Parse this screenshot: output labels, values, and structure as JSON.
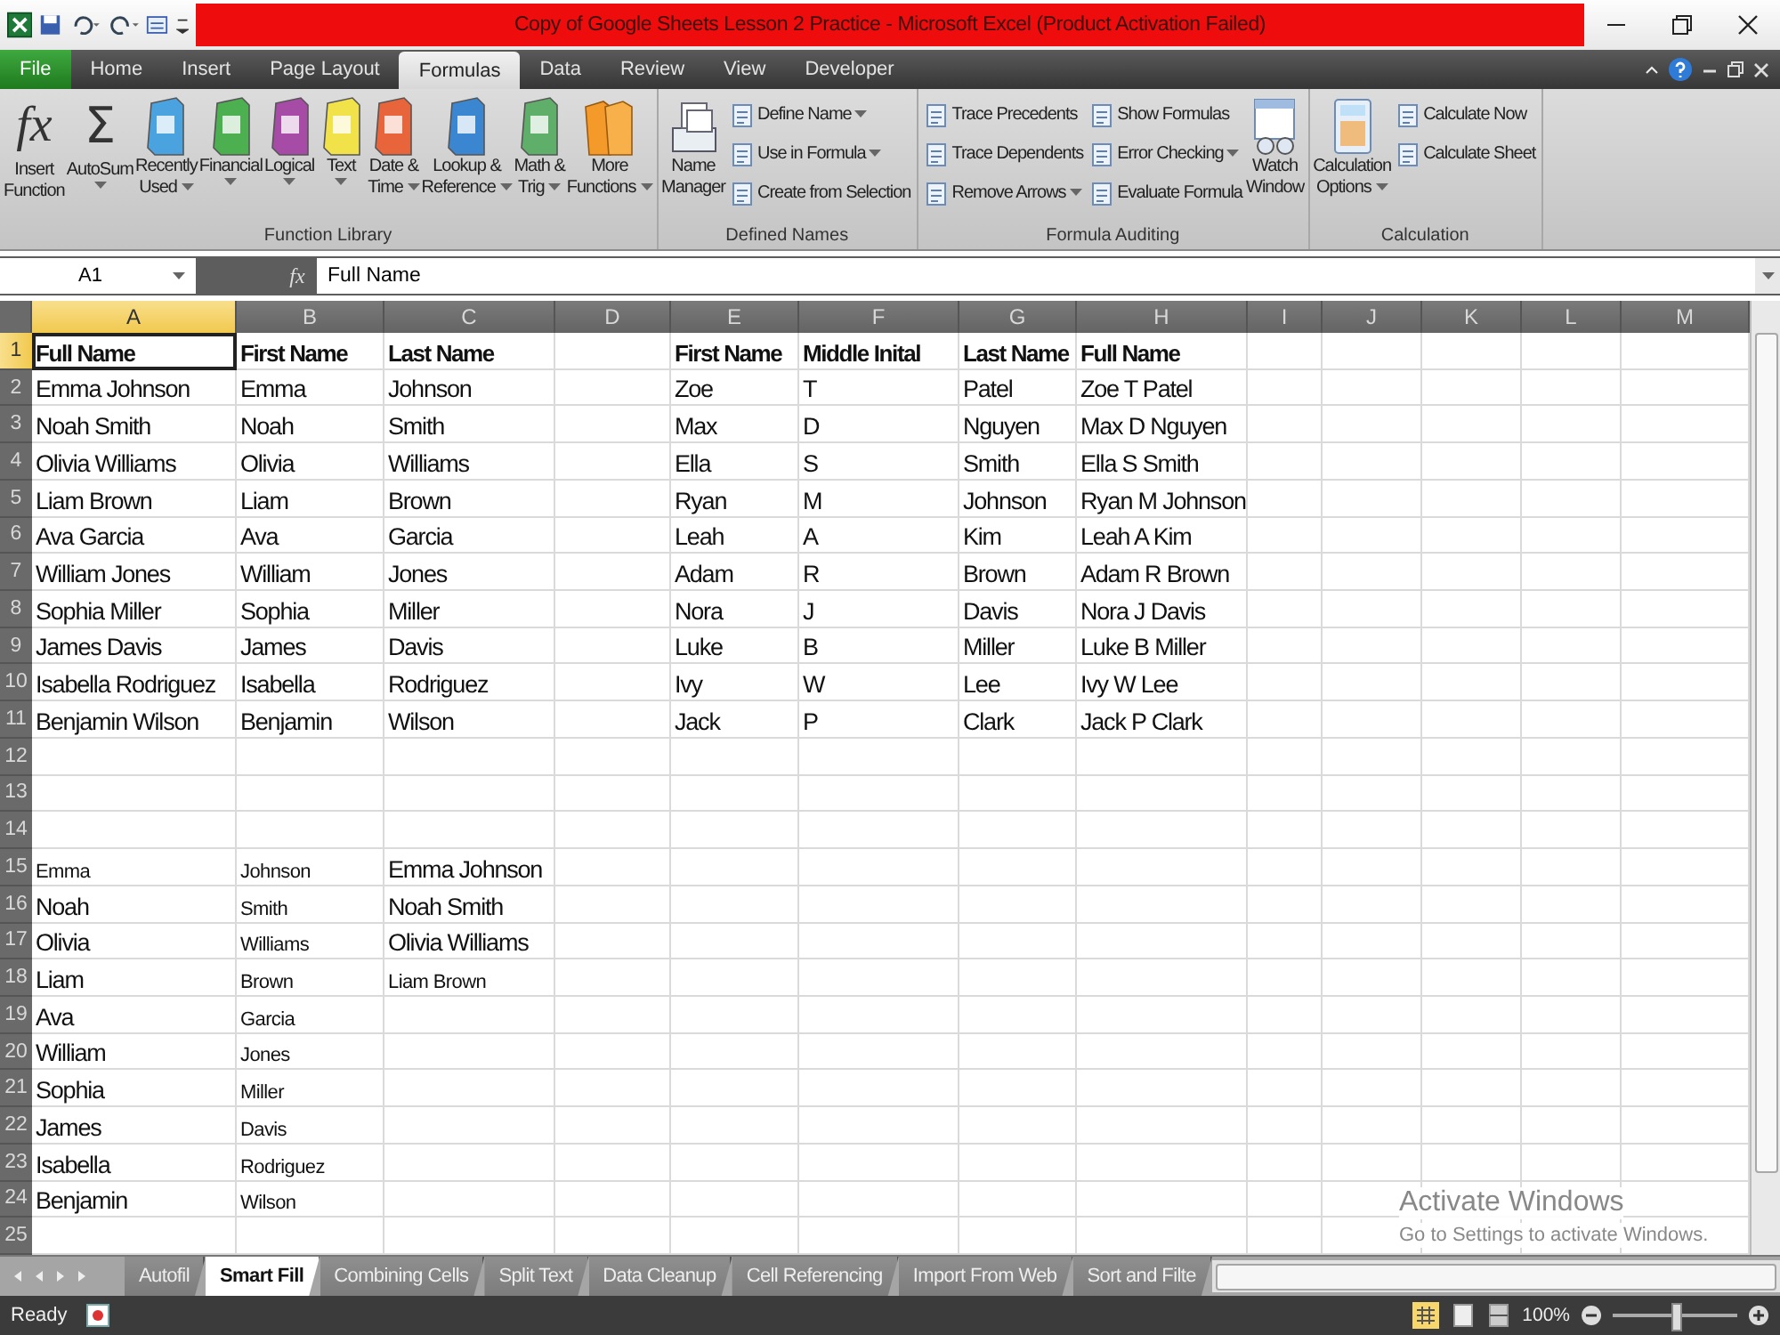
{
  "window": {
    "title": "Copy of Google Sheets Lesson 2 Practice  -  Microsoft Excel (Product Activation Failed)"
  },
  "menu_tabs": [
    {
      "label": "File",
      "kind": "file",
      "selected": false
    },
    {
      "label": "Home",
      "kind": "tab",
      "selected": false
    },
    {
      "label": "Insert",
      "kind": "tab",
      "selected": false
    },
    {
      "label": "Page Layout",
      "kind": "tab",
      "selected": false
    },
    {
      "label": "Formulas",
      "kind": "tab",
      "selected": true
    },
    {
      "label": "Data",
      "kind": "tab",
      "selected": false
    },
    {
      "label": "Review",
      "kind": "tab",
      "selected": false
    },
    {
      "label": "View",
      "kind": "tab",
      "selected": false
    },
    {
      "label": "Developer",
      "kind": "tab",
      "selected": false
    }
  ],
  "ribbon": {
    "groups": [
      {
        "label": "Function Library",
        "items": [
          {
            "kind": "large",
            "glyph": "fx",
            "lines": [
              "Insert",
              "Function"
            ],
            "dropdown": false
          },
          {
            "kind": "large",
            "glyph": "Σ",
            "lines": [
              "AutoSum"
            ],
            "dropdown": true
          },
          {
            "kind": "large",
            "lines": [
              "Recently",
              "Used"
            ],
            "dropdown": true
          },
          {
            "kind": "large",
            "lines": [
              "Financial"
            ],
            "dropdown": true
          },
          {
            "kind": "large",
            "lines": [
              "Logical"
            ],
            "dropdown": true
          },
          {
            "kind": "large",
            "lines": [
              "Text"
            ],
            "dropdown": true
          },
          {
            "kind": "large",
            "lines": [
              "Date &",
              "Time"
            ],
            "dropdown": true
          },
          {
            "kind": "large",
            "lines": [
              "Lookup &",
              "Reference"
            ],
            "dropdown": true
          },
          {
            "kind": "large",
            "lines": [
              "Math &",
              "Trig"
            ],
            "dropdown": true
          },
          {
            "kind": "large",
            "lines": [
              "More",
              "Functions"
            ],
            "dropdown": true
          }
        ]
      },
      {
        "label": "Defined Names",
        "items": [
          {
            "kind": "large",
            "lines": [
              "Name",
              "Manager"
            ],
            "dropdown": false
          },
          {
            "kind": "stack",
            "items": [
              {
                "label": "Define Name",
                "dropdown": true
              },
              {
                "label": "Use in Formula",
                "dropdown": true
              },
              {
                "label": "Create from Selection",
                "dropdown": false
              }
            ]
          }
        ]
      },
      {
        "label": "Formula Auditing",
        "items": [
          {
            "kind": "stack",
            "items": [
              {
                "label": "Trace Precedents",
                "dropdown": false
              },
              {
                "label": "Trace Dependents",
                "dropdown": false
              },
              {
                "label": "Remove Arrows",
                "dropdown": true
              }
            ]
          },
          {
            "kind": "stack",
            "items": [
              {
                "label": "Show Formulas",
                "dropdown": false
              },
              {
                "label": "Error Checking",
                "dropdown": true
              },
              {
                "label": "Evaluate Formula",
                "dropdown": false
              }
            ]
          },
          {
            "kind": "large",
            "lines": [
              "Watch",
              "Window"
            ],
            "dropdown": false
          }
        ]
      },
      {
        "label": "Calculation",
        "items": [
          {
            "kind": "large",
            "lines": [
              "Calculation",
              "Options"
            ],
            "dropdown": true
          },
          {
            "kind": "stack",
            "items": [
              {
                "label": "Calculate Now",
                "dropdown": false
              },
              {
                "label": "Calculate Sheet",
                "dropdown": false
              }
            ]
          }
        ]
      }
    ]
  },
  "formula_bar": {
    "name_box": "A1",
    "fx": "fx",
    "value": "Full Name"
  },
  "sheet": {
    "columns": [
      {
        "label": "A",
        "selected": true
      },
      {
        "label": "B",
        "selected": false
      },
      {
        "label": "C",
        "selected": false
      },
      {
        "label": "D",
        "selected": false
      },
      {
        "label": "E",
        "selected": false
      },
      {
        "label": "F",
        "selected": false
      },
      {
        "label": "G",
        "selected": false
      },
      {
        "label": "H",
        "selected": false
      },
      {
        "label": "I",
        "selected": false
      },
      {
        "label": "J",
        "selected": false
      },
      {
        "label": "K",
        "selected": false
      },
      {
        "label": "L",
        "selected": false
      },
      {
        "label": "M",
        "selected": false
      }
    ],
    "rows": [
      {
        "number": "1",
        "selected": true,
        "cells": [
          {
            "text": "Full Name",
            "kind": "header",
            "active": true
          },
          {
            "text": "First Name",
            "kind": "header"
          },
          {
            "text": "Last Name",
            "kind": "header"
          },
          {},
          {
            "text": "First Name",
            "kind": "header"
          },
          {
            "text": "Middle Inital",
            "kind": "header"
          },
          {
            "text": "Last Name",
            "kind": "header"
          },
          {
            "text": "Full Name",
            "kind": "header"
          }
        ]
      },
      {
        "number": "2",
        "selected": false,
        "cells": [
          {
            "text": "Emma Johnson"
          },
          {
            "text": "Emma"
          },
          {
            "text": "Johnson"
          },
          {},
          {
            "text": "Zoe"
          },
          {
            "text": "T"
          },
          {
            "text": "Patel"
          },
          {
            "text": "Zoe T Patel"
          }
        ]
      },
      {
        "number": "3",
        "selected": false,
        "cells": [
          {
            "text": "Noah Smith"
          },
          {
            "text": "Noah"
          },
          {
            "text": "Smith"
          },
          {},
          {
            "text": "Max"
          },
          {
            "text": "D"
          },
          {
            "text": "Nguyen"
          },
          {
            "text": "Max D Nguyen"
          }
        ]
      },
      {
        "number": "4",
        "selected": false,
        "cells": [
          {
            "text": "Olivia Williams"
          },
          {
            "text": "Olivia"
          },
          {
            "text": "Williams"
          },
          {},
          {
            "text": "Ella"
          },
          {
            "text": "S"
          },
          {
            "text": "Smith"
          },
          {
            "text": "Ella S Smith"
          }
        ]
      },
      {
        "number": "5",
        "selected": false,
        "cells": [
          {
            "text": "Liam Brown"
          },
          {
            "text": "Liam"
          },
          {
            "text": "Brown"
          },
          {},
          {
            "text": "Ryan"
          },
          {
            "text": "M"
          },
          {
            "text": "Johnson"
          },
          {
            "text": "Ryan M Johnson"
          }
        ]
      },
      {
        "number": "6",
        "selected": false,
        "cells": [
          {
            "text": "Ava Garcia"
          },
          {
            "text": "Ava"
          },
          {
            "text": "Garcia"
          },
          {},
          {
            "text": "Leah"
          },
          {
            "text": "A"
          },
          {
            "text": "Kim"
          },
          {
            "text": "Leah A Kim"
          }
        ]
      },
      {
        "number": "7",
        "selected": false,
        "cells": [
          {
            "text": "William Jones"
          },
          {
            "text": "William"
          },
          {
            "text": "Jones"
          },
          {},
          {
            "text": "Adam"
          },
          {
            "text": "R"
          },
          {
            "text": "Brown"
          },
          {
            "text": "Adam R Brown"
          }
        ]
      },
      {
        "number": "8",
        "selected": false,
        "cells": [
          {
            "text": "Sophia Miller"
          },
          {
            "text": "Sophia"
          },
          {
            "text": "Miller"
          },
          {},
          {
            "text": "Nora"
          },
          {
            "text": "J"
          },
          {
            "text": "Davis"
          },
          {
            "text": "Nora J Davis"
          }
        ]
      },
      {
        "number": "9",
        "selected": false,
        "cells": [
          {
            "text": "James Davis"
          },
          {
            "text": "James"
          },
          {
            "text": "Davis"
          },
          {},
          {
            "text": "Luke"
          },
          {
            "text": "B"
          },
          {
            "text": "Miller"
          },
          {
            "text": "Luke B Miller"
          }
        ]
      },
      {
        "number": "10",
        "selected": false,
        "cells": [
          {
            "text": "Isabella Rodriguez"
          },
          {
            "text": "Isabella"
          },
          {
            "text": "Rodriguez"
          },
          {},
          {
            "text": "Ivy"
          },
          {
            "text": "W"
          },
          {
            "text": "Lee"
          },
          {
            "text": "Ivy W Lee"
          }
        ]
      },
      {
        "number": "11",
        "selected": false,
        "cells": [
          {
            "text": "Benjamin Wilson"
          },
          {
            "text": "Benjamin"
          },
          {
            "text": "Wilson"
          },
          {},
          {
            "text": "Jack"
          },
          {
            "text": "P"
          },
          {
            "text": "Clark"
          },
          {
            "text": "Jack P Clark"
          }
        ]
      },
      {
        "number": "12",
        "selected": false
      },
      {
        "number": "13",
        "selected": false
      },
      {
        "number": "14",
        "selected": false
      },
      {
        "number": "15",
        "selected": false,
        "cells": [
          {
            "text": "Emma",
            "kind": "small"
          },
          {
            "text": "Johnson",
            "kind": "small"
          },
          {
            "text": "Emma Johnson"
          }
        ]
      },
      {
        "number": "16",
        "selected": false,
        "cells": [
          {
            "text": "Noah"
          },
          {
            "text": "Smith",
            "kind": "small"
          },
          {
            "text": "Noah Smith"
          }
        ]
      },
      {
        "number": "17",
        "selected": false,
        "cells": [
          {
            "text": "Olivia"
          },
          {
            "text": "Williams",
            "kind": "small"
          },
          {
            "text": "Olivia Williams"
          }
        ]
      },
      {
        "number": "18",
        "selected": false,
        "cells": [
          {
            "text": "Liam"
          },
          {
            "text": "Brown",
            "kind": "small"
          },
          {
            "text": "Liam Brown",
            "kind": "small"
          }
        ]
      },
      {
        "number": "19",
        "selected": false,
        "cells": [
          {
            "text": "Ava"
          },
          {
            "text": "Garcia",
            "kind": "small"
          }
        ]
      },
      {
        "number": "20",
        "selected": false,
        "cells": [
          {
            "text": "William"
          },
          {
            "text": "Jones",
            "kind": "small"
          }
        ]
      },
      {
        "number": "21",
        "selected": false,
        "cells": [
          {
            "text": "Sophia"
          },
          {
            "text": "Miller",
            "kind": "small"
          }
        ]
      },
      {
        "number": "22",
        "selected": false,
        "cells": [
          {
            "text": "James"
          },
          {
            "text": "Davis",
            "kind": "small"
          }
        ]
      },
      {
        "number": "23",
        "selected": false,
        "cells": [
          {
            "text": "Isabella"
          },
          {
            "text": "Rodriguez",
            "kind": "small"
          }
        ]
      },
      {
        "number": "24",
        "selected": false,
        "cells": [
          {
            "text": "Benjamin"
          },
          {
            "text": "Wilson",
            "kind": "small"
          }
        ]
      },
      {
        "number": "25",
        "selected": false
      }
    ]
  },
  "sheet_tabs": [
    {
      "label": "Autofil",
      "selected": false
    },
    {
      "label": "Smart Fill",
      "selected": true
    },
    {
      "label": "Combining Cells",
      "selected": false
    },
    {
      "label": "Split Text",
      "selected": false
    },
    {
      "label": "Data Cleanup",
      "selected": false
    },
    {
      "label": "Cell Referencing",
      "selected": false
    },
    {
      "label": "Import From Web",
      "selected": false
    },
    {
      "label": "Sort and Filte",
      "selected": false
    }
  ],
  "activation_notice": {
    "title": "Activate Windows",
    "text": "Go to Settings to activate Windows."
  },
  "status_bar": {
    "status": "Ready",
    "zoom": {
      "label": "100%",
      "level": 0.52
    }
  }
}
